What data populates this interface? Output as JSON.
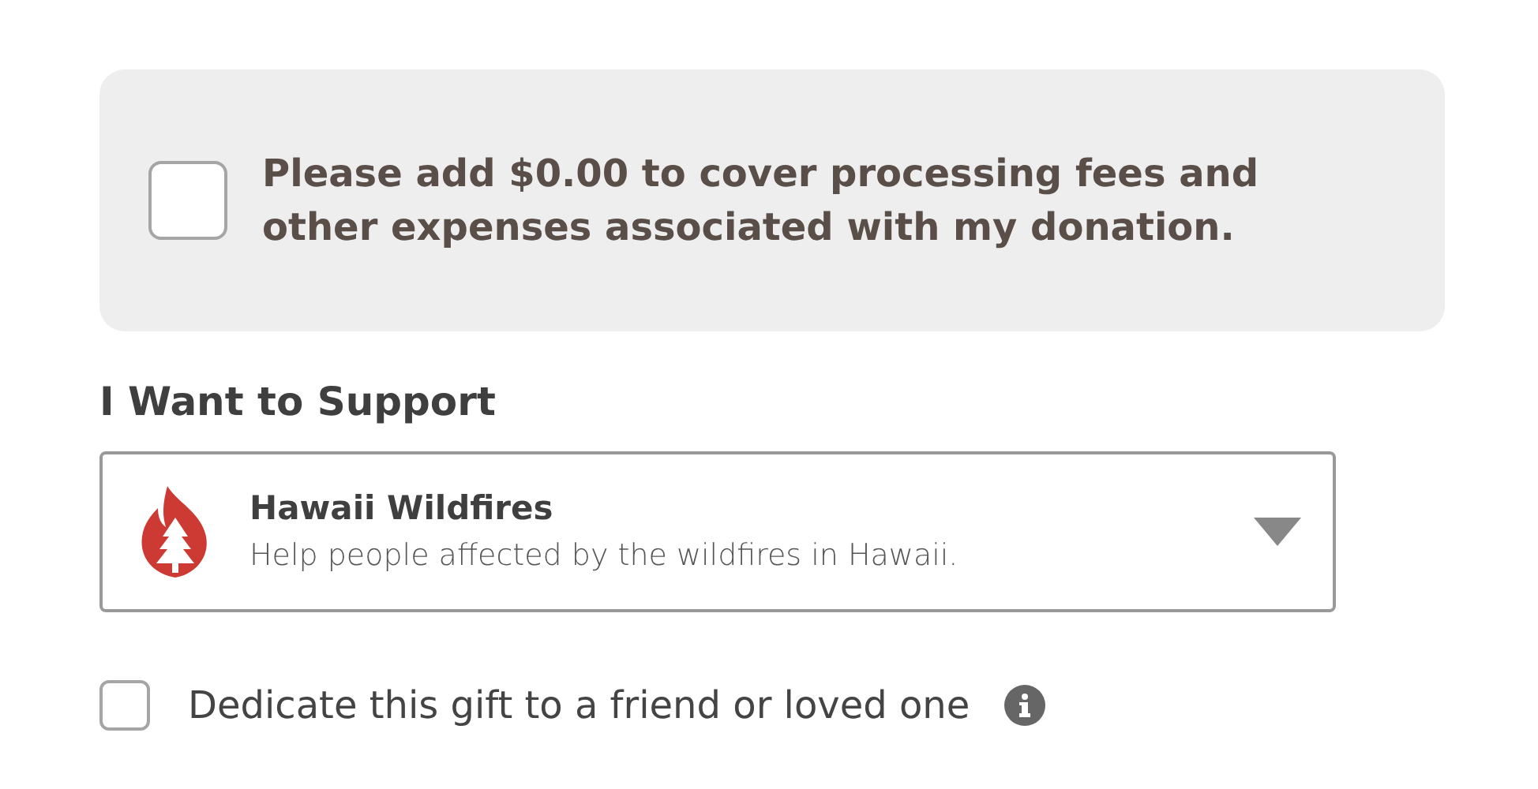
{
  "fee_option": {
    "checked": false,
    "label": "Please add $0.00 to cover processing fees and other expenses associated with my donation."
  },
  "support": {
    "heading": "I Want to Support",
    "selected_fund": {
      "title": "Hawaii Wildfires",
      "description": "Help people affected by the wildfires in Hawaii."
    }
  },
  "dedicate_option": {
    "checked": false,
    "label": "Dedicate this gift to a friend or loved one"
  }
}
